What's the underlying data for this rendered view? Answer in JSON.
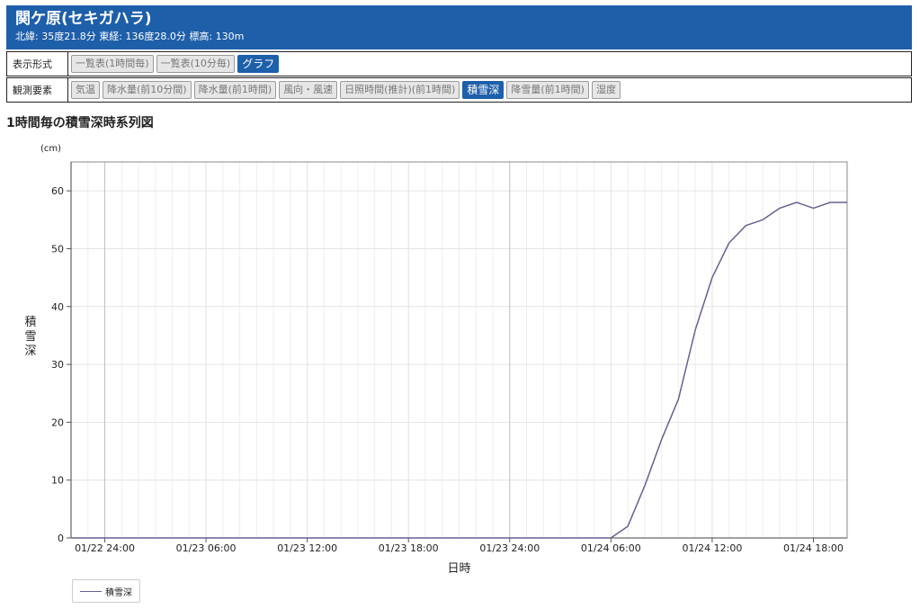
{
  "station": {
    "title": "関ケ原(セキガハラ)",
    "subtitle": "北緯: 35度21.8分 東経: 136度28.0分 標高: 130m"
  },
  "display_format": {
    "label": "表示形式",
    "buttons": [
      {
        "label": "一覧表(1時間毎)",
        "active": false
      },
      {
        "label": "一覧表(10分毎)",
        "active": false
      },
      {
        "label": "グラフ",
        "active": true
      }
    ]
  },
  "elements": {
    "label": "観測要素",
    "buttons": [
      {
        "label": "気温",
        "active": false
      },
      {
        "label": "降水量(前10分間)",
        "active": false
      },
      {
        "label": "降水量(前1時間)",
        "active": false
      },
      {
        "label": "風向・風速",
        "active": false
      },
      {
        "label": "日照時間(推計)(前1時間)",
        "active": false
      },
      {
        "label": "積雪深",
        "active": true
      },
      {
        "label": "降雪量(前1時間)",
        "active": false
      },
      {
        "label": "湿度",
        "active": false
      }
    ]
  },
  "chart_title": "1時間毎の積雪深時系列図",
  "colors": {
    "header": "#1e5faa",
    "series": "#6a5f8f"
  },
  "chart_data": {
    "type": "line",
    "x_start": "01/22 22:00",
    "x_end": "01/24 20:00",
    "xlabel": "日時",
    "ylabel": "積雪深",
    "yunit": "(cm)",
    "ylim": [
      0,
      65
    ],
    "yticks": [
      0,
      10,
      20,
      30,
      40,
      50,
      60
    ],
    "xticks": [
      "01/22 24:00",
      "01/23 06:00",
      "01/23 12:00",
      "01/23 18:00",
      "01/23 24:00",
      "01/24 06:00",
      "01/24 12:00",
      "01/24 18:00"
    ],
    "grid": true,
    "legend": "bottom-left",
    "series": [
      {
        "name": "積雪深",
        "x": [
          "01/22 22:00",
          "01/22 23:00",
          "01/22 24:00",
          "01/23 01:00",
          "01/23 02:00",
          "01/23 03:00",
          "01/23 04:00",
          "01/23 05:00",
          "01/23 06:00",
          "01/23 07:00",
          "01/23 08:00",
          "01/23 09:00",
          "01/23 10:00",
          "01/23 11:00",
          "01/23 12:00",
          "01/23 13:00",
          "01/23 14:00",
          "01/23 15:00",
          "01/23 16:00",
          "01/23 17:00",
          "01/23 18:00",
          "01/23 19:00",
          "01/23 20:00",
          "01/23 21:00",
          "01/23 22:00",
          "01/23 23:00",
          "01/23 24:00",
          "01/24 01:00",
          "01/24 02:00",
          "01/24 03:00",
          "01/24 04:00",
          "01/24 05:00",
          "01/24 06:00",
          "01/24 07:00",
          "01/24 08:00",
          "01/24 09:00",
          "01/24 10:00",
          "01/24 11:00",
          "01/24 12:00",
          "01/24 13:00",
          "01/24 14:00",
          "01/24 15:00",
          "01/24 16:00",
          "01/24 17:00",
          "01/24 18:00",
          "01/24 19:00",
          "01/24 20:00"
        ],
        "values": [
          0,
          0,
          0,
          0,
          0,
          0,
          0,
          0,
          0,
          0,
          0,
          0,
          0,
          0,
          0,
          0,
          0,
          0,
          0,
          0,
          0,
          0,
          0,
          0,
          0,
          0,
          0,
          0,
          0,
          0,
          0,
          0,
          0,
          2,
          9,
          17,
          24,
          36,
          45,
          51,
          54,
          55,
          57,
          58,
          57,
          58,
          58
        ]
      }
    ]
  }
}
